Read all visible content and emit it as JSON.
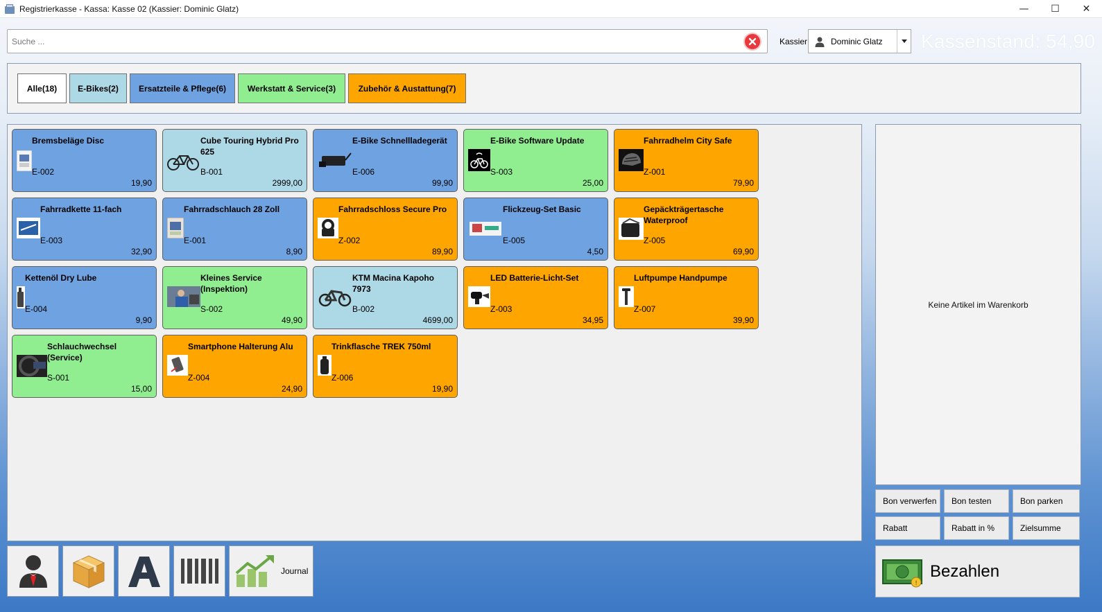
{
  "window": {
    "title": "Registrierkasse - Kassa: Kasse 02 (Kassier: Dominic Glatz)",
    "minimize_glyph": "—",
    "maximize_glyph": "☐",
    "close_glyph": "✕"
  },
  "search": {
    "placeholder": "Suche ...",
    "value": ""
  },
  "kassier": {
    "label": "Kassier",
    "selected": "Dominic Glatz"
  },
  "kassenstand": "Kassenstand: 54,90",
  "categories": [
    {
      "label": "Alle(18)",
      "color": "#ffffff"
    },
    {
      "label": "E-Bikes(2)",
      "color": "#add8e6"
    },
    {
      "label": "Ersatzteile & Pflege(6)",
      "color": "#6fa2e0"
    },
    {
      "label": "Werkstatt & Service(3)",
      "color": "#90ee90"
    },
    {
      "label": "Zubehör & Austattung(7)",
      "color": "#ffa500"
    }
  ],
  "colors": {
    "ebikes": "#add8e6",
    "ersatzteile": "#6fa2e0",
    "werkstatt": "#90ee90",
    "zubehoer": "#ffa500",
    "clear_icon": "#e8383d"
  },
  "articles": [
    {
      "name": "Bremsbeläge Disc",
      "code": "E-002",
      "price": "19,90",
      "cat": "ersatzteile",
      "icon": "brake-pads-icon"
    },
    {
      "name": "Cube Touring Hybrid Pro 625",
      "code": "B-001",
      "price": "2999,00",
      "cat": "ebikes",
      "icon": "bicycle-icon"
    },
    {
      "name": "E-Bike Schnellladegerät",
      "code": "E-006",
      "price": "99,90",
      "cat": "ersatzteile",
      "icon": "charger-icon"
    },
    {
      "name": "E-Bike Software Update",
      "code": "S-003",
      "price": "25,00",
      "cat": "werkstatt",
      "icon": "bike-update-icon"
    },
    {
      "name": "Fahrradhelm City Safe",
      "code": "Z-001",
      "price": "79,90",
      "cat": "zubehoer",
      "icon": "helmet-icon"
    },
    {
      "name": "Fahrradkette 11-fach",
      "code": "E-003",
      "price": "32,90",
      "cat": "ersatzteile",
      "icon": "chain-box-icon"
    },
    {
      "name": "Fahrradschlauch 28 Zoll",
      "code": "E-001",
      "price": "8,90",
      "cat": "ersatzteile",
      "icon": "tube-box-icon"
    },
    {
      "name": "Fahrradschloss Secure Pro",
      "code": "Z-002",
      "price": "89,90",
      "cat": "zubehoer",
      "icon": "lock-icon"
    },
    {
      "name": "Flickzeug-Set Basic",
      "code": "E-005",
      "price": "4,50",
      "cat": "ersatzteile",
      "icon": "repair-kit-icon"
    },
    {
      "name": "Gepäckträgertasche Waterproof",
      "code": "Z-005",
      "price": "69,90",
      "cat": "zubehoer",
      "icon": "bag-icon"
    },
    {
      "name": "Kettenöl Dry Lube",
      "code": "E-004",
      "price": "9,90",
      "cat": "ersatzteile",
      "icon": "oil-bottle-icon"
    },
    {
      "name": "Kleines Service (Inspektion)",
      "code": "S-002",
      "price": "49,90",
      "cat": "werkstatt",
      "icon": "mechanic-icon"
    },
    {
      "name": "KTM Macina Kapoho 7973",
      "code": "B-002",
      "price": "4699,00",
      "cat": "ebikes",
      "icon": "mountain-bike-icon"
    },
    {
      "name": "LED Batterie-Licht-Set",
      "code": "Z-003",
      "price": "34,95",
      "cat": "zubehoer",
      "icon": "bike-light-icon"
    },
    {
      "name": "Luftpumpe Handpumpe",
      "code": "Z-007",
      "price": "39,90",
      "cat": "zubehoer",
      "icon": "pump-icon"
    },
    {
      "name": "Schlauchwechsel (Service)",
      "code": "S-001",
      "price": "15,00",
      "cat": "werkstatt",
      "icon": "tube-change-icon"
    },
    {
      "name": "Smartphone Halterung Alu",
      "code": "Z-004",
      "price": "24,90",
      "cat": "zubehoer",
      "icon": "phone-mount-icon"
    },
    {
      "name": "Trinkflasche TREK 750ml",
      "code": "Z-006",
      "price": "19,90",
      "cat": "zubehoer",
      "icon": "bottle-icon"
    }
  ],
  "cart": {
    "empty_text": "Keine Artikel im Warenkorb"
  },
  "actions": [
    {
      "label": "Bon verwerfen"
    },
    {
      "label": "Bon testen"
    },
    {
      "label": "Bon parken"
    },
    {
      "label": "Rabatt"
    },
    {
      "label": "Rabatt in %"
    },
    {
      "label": "Zielsumme"
    }
  ],
  "pay": {
    "label": "Bezahlen",
    "icon": "money-icon"
  },
  "tools": [
    {
      "name": "user-icon",
      "label": ""
    },
    {
      "name": "package-icon",
      "label": ""
    },
    {
      "name": "letter-a-icon",
      "label": ""
    },
    {
      "name": "barcode-icon",
      "label": ""
    },
    {
      "name": "journal-chart-icon",
      "label": "Journal"
    }
  ]
}
